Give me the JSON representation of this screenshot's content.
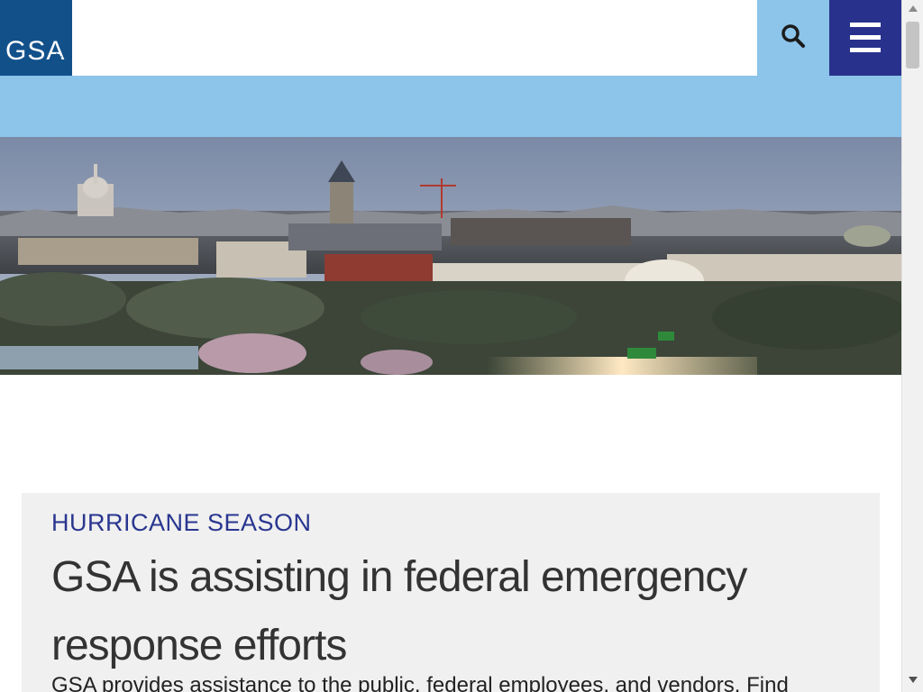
{
  "header": {
    "logo_text": "GSA",
    "search_icon": "search-icon",
    "menu_icon": "hamburger-menu-icon"
  },
  "colors": {
    "brand_dark_blue": "#12508a",
    "header_light_blue": "#8cc4ea",
    "menu_navy": "#28318c",
    "eyebrow_blue": "#29368f",
    "card_gray": "#f0f0f0"
  },
  "feature": {
    "eyebrow": "HURRICANE SEASON",
    "headline": "GSA is assisting in federal emergency response efforts",
    "summary": "GSA provides assistance to the public, federal employees, and vendors. Find"
  }
}
